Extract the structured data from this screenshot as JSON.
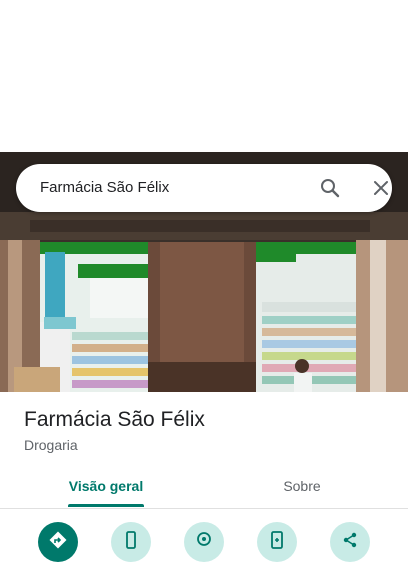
{
  "search": {
    "query": "Farmácia São Félix"
  },
  "place": {
    "name": "Farmácia São Félix",
    "category": "Drogaria"
  },
  "tabs": [
    {
      "label": "Visão geral",
      "selected": true
    },
    {
      "label": "Sobre",
      "selected": false
    }
  ],
  "actions": [
    {
      "icon": "directions-icon",
      "primary": true
    },
    {
      "icon": "phone-icon",
      "primary": false
    },
    {
      "icon": "save-location-icon",
      "primary": false
    },
    {
      "icon": "send-to-phone-icon",
      "primary": false
    },
    {
      "icon": "share-icon",
      "primary": false
    }
  ],
  "colors": {
    "accent": "#00796b",
    "action_bg": "#c8ebe6",
    "text_primary": "#202124",
    "text_secondary": "#5f6368"
  }
}
